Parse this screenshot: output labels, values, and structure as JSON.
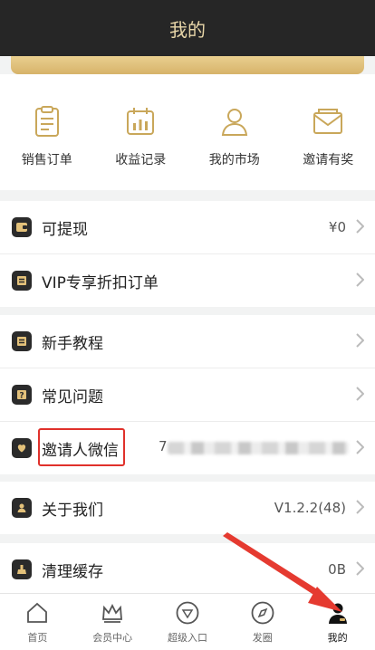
{
  "header": {
    "title": "我的"
  },
  "quick_actions": [
    {
      "label": "销售订单",
      "icon": "clipboard-icon"
    },
    {
      "label": "收益记录",
      "icon": "calendar-chart-icon"
    },
    {
      "label": "我的市场",
      "icon": "user-icon"
    },
    {
      "label": "邀请有奖",
      "icon": "envelope-icon"
    }
  ],
  "menu": {
    "withdraw": {
      "label": "可提现",
      "value": "¥0",
      "icon": "wallet-icon"
    },
    "vip_orders": {
      "label": "VIP专享折扣订单",
      "icon": "list-icon"
    },
    "tutorial": {
      "label": "新手教程",
      "icon": "book-icon"
    },
    "faq": {
      "label": "常见问题",
      "icon": "question-icon"
    },
    "inviter_wechat": {
      "label": "邀请人微信",
      "value_prefix": "7",
      "icon": "heart-icon"
    },
    "about": {
      "label": "关于我们",
      "value": "V1.2.2(48)",
      "icon": "person-icon"
    },
    "clear_cache": {
      "label": "清理缓存",
      "value": "0B",
      "icon": "broom-icon"
    }
  },
  "tabs": [
    {
      "label": "首页",
      "icon": "home-icon"
    },
    {
      "label": "会员中心",
      "icon": "crown-icon"
    },
    {
      "label": "超级入口",
      "icon": "diamond-icon"
    },
    {
      "label": "发圈",
      "icon": "compass-icon"
    },
    {
      "label": "我的",
      "icon": "profile-icon",
      "active": true
    }
  ],
  "colors": {
    "header_bg": "#262626",
    "gold": "#d7b36a",
    "annotation_red": "#e0312b"
  }
}
